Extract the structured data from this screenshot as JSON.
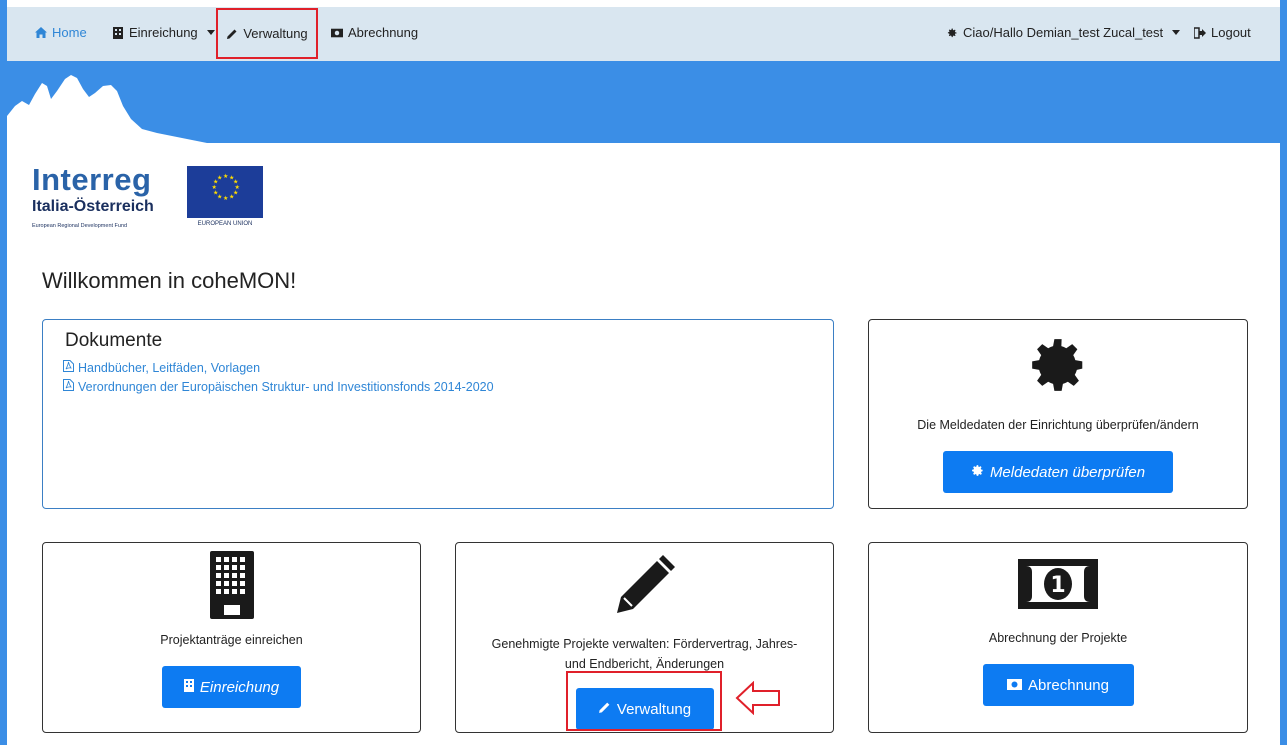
{
  "nav": {
    "home": "Home",
    "einreichung": "Einreichung",
    "verwaltung": "Verwaltung",
    "abrechnung": "Abrechnung",
    "user": "Ciao/Hallo Demian_test Zucal_test",
    "logout": "Logout"
  },
  "logo": {
    "title": "Interreg",
    "subtitle": "Italia-Österreich",
    "fund": "European Regional Development Fund",
    "eu": "EUROPEAN UNION"
  },
  "welcome": "Willkommen in coheMON!",
  "documents": {
    "title": "Dokumente",
    "links": [
      "Handbücher, Leitfäden, Vorlagen",
      "Verordnungen der Europäischen Struktur- und Investitionsfonds 2014-2020"
    ]
  },
  "meldedaten": {
    "text": "Die Meldedaten der Einrichtung überprüfen/ändern",
    "button": "Meldedaten überprüfen"
  },
  "einreichung_card": {
    "text": "Projektanträge einreichen",
    "button": "Einreichung"
  },
  "verwaltung_card": {
    "text_line1": "Genehmigte Projekte verwalten: Fördervertrag, Jahres-",
    "text_line2": "und Endbericht, Änderungen",
    "button": "Verwaltung"
  },
  "abrechnung_card": {
    "text": "Abrechnung der Projekte",
    "button": "Abrechnung"
  },
  "colors": {
    "primary": "#0d7bf2",
    "banner": "#3b8ee6",
    "navbar": "#d9e6f0",
    "highlight": "#e0202a"
  }
}
